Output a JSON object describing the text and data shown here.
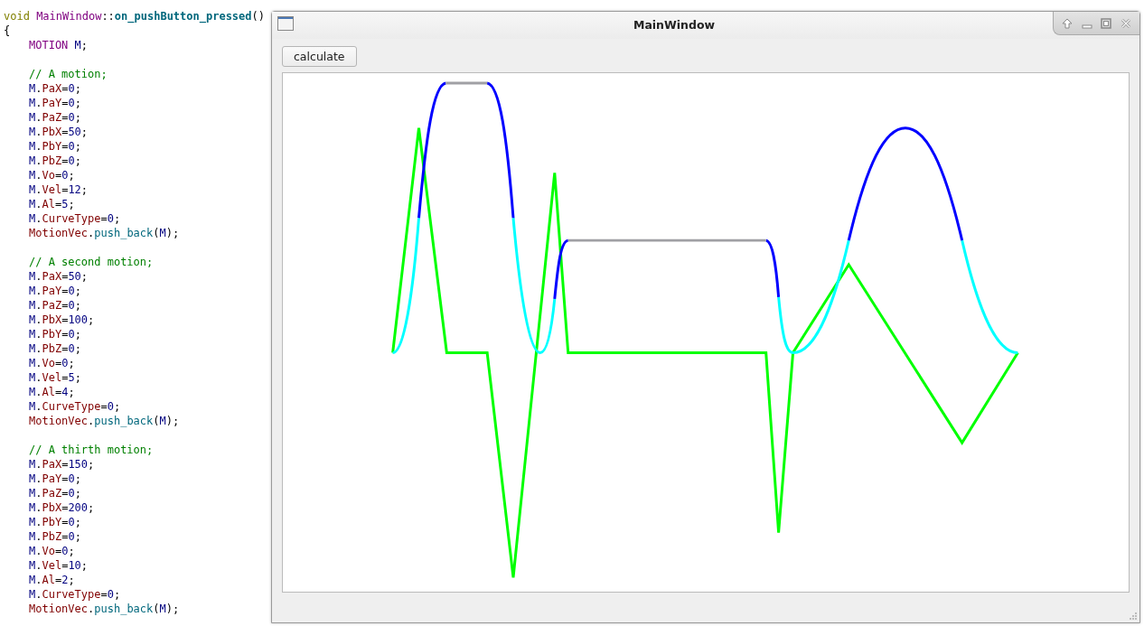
{
  "code_editor": {
    "lines": [
      {
        "kind": "code",
        "indented": false,
        "tokens": [
          {
            "kind": "keyword",
            "text": "void "
          },
          {
            "kind": "type",
            "text": "MainWindow"
          },
          {
            "kind": "plain",
            "text": "::"
          },
          {
            "kind": "funcdef",
            "text": "on_pushButton_pressed"
          },
          {
            "kind": "plain",
            "text": "()"
          }
        ]
      },
      {
        "kind": "code",
        "indented": false,
        "tokens": [
          {
            "kind": "plain",
            "text": "{"
          }
        ]
      },
      {
        "kind": "code",
        "indented": true,
        "tokens": [
          {
            "kind": "type",
            "text": "MOTION "
          },
          {
            "kind": "var",
            "text": "M"
          },
          {
            "kind": "plain",
            "text": ";"
          }
        ]
      },
      {
        "kind": "blank"
      },
      {
        "kind": "code",
        "indented": true,
        "tokens": [
          {
            "kind": "comment",
            "text": "// A motion;"
          }
        ]
      },
      {
        "kind": "code",
        "indented": true,
        "tokens": [
          {
            "kind": "var",
            "text": "M"
          },
          {
            "kind": "plain",
            "text": "."
          },
          {
            "kind": "member",
            "text": "PaX"
          },
          {
            "kind": "plain",
            "text": "="
          },
          {
            "kind": "number",
            "text": "0"
          },
          {
            "kind": "plain",
            "text": ";"
          }
        ]
      },
      {
        "kind": "code",
        "indented": true,
        "tokens": [
          {
            "kind": "var",
            "text": "M"
          },
          {
            "kind": "plain",
            "text": "."
          },
          {
            "kind": "member",
            "text": "PaY"
          },
          {
            "kind": "plain",
            "text": "="
          },
          {
            "kind": "number",
            "text": "0"
          },
          {
            "kind": "plain",
            "text": ";"
          }
        ]
      },
      {
        "kind": "code",
        "indented": true,
        "tokens": [
          {
            "kind": "var",
            "text": "M"
          },
          {
            "kind": "plain",
            "text": "."
          },
          {
            "kind": "member",
            "text": "PaZ"
          },
          {
            "kind": "plain",
            "text": "="
          },
          {
            "kind": "number",
            "text": "0"
          },
          {
            "kind": "plain",
            "text": ";"
          }
        ]
      },
      {
        "kind": "code",
        "indented": true,
        "tokens": [
          {
            "kind": "var",
            "text": "M"
          },
          {
            "kind": "plain",
            "text": "."
          },
          {
            "kind": "member",
            "text": "PbX"
          },
          {
            "kind": "plain",
            "text": "="
          },
          {
            "kind": "number",
            "text": "50"
          },
          {
            "kind": "plain",
            "text": ";"
          }
        ]
      },
      {
        "kind": "code",
        "indented": true,
        "tokens": [
          {
            "kind": "var",
            "text": "M"
          },
          {
            "kind": "plain",
            "text": "."
          },
          {
            "kind": "member",
            "text": "PbY"
          },
          {
            "kind": "plain",
            "text": "="
          },
          {
            "kind": "number",
            "text": "0"
          },
          {
            "kind": "plain",
            "text": ";"
          }
        ]
      },
      {
        "kind": "code",
        "indented": true,
        "tokens": [
          {
            "kind": "var",
            "text": "M"
          },
          {
            "kind": "plain",
            "text": "."
          },
          {
            "kind": "member",
            "text": "PbZ"
          },
          {
            "kind": "plain",
            "text": "="
          },
          {
            "kind": "number",
            "text": "0"
          },
          {
            "kind": "plain",
            "text": ";"
          }
        ]
      },
      {
        "kind": "code",
        "indented": true,
        "tokens": [
          {
            "kind": "var",
            "text": "M"
          },
          {
            "kind": "plain",
            "text": "."
          },
          {
            "kind": "member",
            "text": "Vo"
          },
          {
            "kind": "plain",
            "text": "="
          },
          {
            "kind": "number",
            "text": "0"
          },
          {
            "kind": "plain",
            "text": ";"
          }
        ]
      },
      {
        "kind": "code",
        "indented": true,
        "tokens": [
          {
            "kind": "var",
            "text": "M"
          },
          {
            "kind": "plain",
            "text": "."
          },
          {
            "kind": "member",
            "text": "Vel"
          },
          {
            "kind": "plain",
            "text": "="
          },
          {
            "kind": "number",
            "text": "12"
          },
          {
            "kind": "plain",
            "text": ";"
          }
        ]
      },
      {
        "kind": "code",
        "indented": true,
        "tokens": [
          {
            "kind": "var",
            "text": "M"
          },
          {
            "kind": "plain",
            "text": "."
          },
          {
            "kind": "member",
            "text": "Al"
          },
          {
            "kind": "plain",
            "text": "="
          },
          {
            "kind": "number",
            "text": "5"
          },
          {
            "kind": "plain",
            "text": ";"
          }
        ]
      },
      {
        "kind": "code",
        "indented": true,
        "tokens": [
          {
            "kind": "var",
            "text": "M"
          },
          {
            "kind": "plain",
            "text": "."
          },
          {
            "kind": "member",
            "text": "CurveType"
          },
          {
            "kind": "plain",
            "text": "="
          },
          {
            "kind": "number",
            "text": "0"
          },
          {
            "kind": "plain",
            "text": ";"
          }
        ]
      },
      {
        "kind": "code",
        "indented": true,
        "tokens": [
          {
            "kind": "member",
            "text": "MotionVec"
          },
          {
            "kind": "plain",
            "text": "."
          },
          {
            "kind": "func",
            "text": "push_back"
          },
          {
            "kind": "plain",
            "text": "("
          },
          {
            "kind": "var",
            "text": "M"
          },
          {
            "kind": "plain",
            "text": ");"
          }
        ]
      },
      {
        "kind": "blank"
      },
      {
        "kind": "code",
        "indented": true,
        "tokens": [
          {
            "kind": "comment",
            "text": "// A second motion;"
          }
        ]
      },
      {
        "kind": "code",
        "indented": true,
        "tokens": [
          {
            "kind": "var",
            "text": "M"
          },
          {
            "kind": "plain",
            "text": "."
          },
          {
            "kind": "member",
            "text": "PaX"
          },
          {
            "kind": "plain",
            "text": "="
          },
          {
            "kind": "number",
            "text": "50"
          },
          {
            "kind": "plain",
            "text": ";"
          }
        ]
      },
      {
        "kind": "code",
        "indented": true,
        "tokens": [
          {
            "kind": "var",
            "text": "M"
          },
          {
            "kind": "plain",
            "text": "."
          },
          {
            "kind": "member",
            "text": "PaY"
          },
          {
            "kind": "plain",
            "text": "="
          },
          {
            "kind": "number",
            "text": "0"
          },
          {
            "kind": "plain",
            "text": ";"
          }
        ]
      },
      {
        "kind": "code",
        "indented": true,
        "tokens": [
          {
            "kind": "var",
            "text": "M"
          },
          {
            "kind": "plain",
            "text": "."
          },
          {
            "kind": "member",
            "text": "PaZ"
          },
          {
            "kind": "plain",
            "text": "="
          },
          {
            "kind": "number",
            "text": "0"
          },
          {
            "kind": "plain",
            "text": ";"
          }
        ]
      },
      {
        "kind": "code",
        "indented": true,
        "tokens": [
          {
            "kind": "var",
            "text": "M"
          },
          {
            "kind": "plain",
            "text": "."
          },
          {
            "kind": "member",
            "text": "PbX"
          },
          {
            "kind": "plain",
            "text": "="
          },
          {
            "kind": "number",
            "text": "100"
          },
          {
            "kind": "plain",
            "text": ";"
          }
        ]
      },
      {
        "kind": "code",
        "indented": true,
        "tokens": [
          {
            "kind": "var",
            "text": "M"
          },
          {
            "kind": "plain",
            "text": "."
          },
          {
            "kind": "member",
            "text": "PbY"
          },
          {
            "kind": "plain",
            "text": "="
          },
          {
            "kind": "number",
            "text": "0"
          },
          {
            "kind": "plain",
            "text": ";"
          }
        ]
      },
      {
        "kind": "code",
        "indented": true,
        "tokens": [
          {
            "kind": "var",
            "text": "M"
          },
          {
            "kind": "plain",
            "text": "."
          },
          {
            "kind": "member",
            "text": "PbZ"
          },
          {
            "kind": "plain",
            "text": "="
          },
          {
            "kind": "number",
            "text": "0"
          },
          {
            "kind": "plain",
            "text": ";"
          }
        ]
      },
      {
        "kind": "code",
        "indented": true,
        "tokens": [
          {
            "kind": "var",
            "text": "M"
          },
          {
            "kind": "plain",
            "text": "."
          },
          {
            "kind": "member",
            "text": "Vo"
          },
          {
            "kind": "plain",
            "text": "="
          },
          {
            "kind": "number",
            "text": "0"
          },
          {
            "kind": "plain",
            "text": ";"
          }
        ]
      },
      {
        "kind": "code",
        "indented": true,
        "tokens": [
          {
            "kind": "var",
            "text": "M"
          },
          {
            "kind": "plain",
            "text": "."
          },
          {
            "kind": "member",
            "text": "Vel"
          },
          {
            "kind": "plain",
            "text": "="
          },
          {
            "kind": "number",
            "text": "5"
          },
          {
            "kind": "plain",
            "text": ";"
          }
        ]
      },
      {
        "kind": "code",
        "indented": true,
        "tokens": [
          {
            "kind": "var",
            "text": "M"
          },
          {
            "kind": "plain",
            "text": "."
          },
          {
            "kind": "member",
            "text": "Al"
          },
          {
            "kind": "plain",
            "text": "="
          },
          {
            "kind": "number",
            "text": "4"
          },
          {
            "kind": "plain",
            "text": ";"
          }
        ]
      },
      {
        "kind": "code",
        "indented": true,
        "tokens": [
          {
            "kind": "var",
            "text": "M"
          },
          {
            "kind": "plain",
            "text": "."
          },
          {
            "kind": "member",
            "text": "CurveType"
          },
          {
            "kind": "plain",
            "text": "="
          },
          {
            "kind": "number",
            "text": "0"
          },
          {
            "kind": "plain",
            "text": ";"
          }
        ]
      },
      {
        "kind": "code",
        "indented": true,
        "tokens": [
          {
            "kind": "member",
            "text": "MotionVec"
          },
          {
            "kind": "plain",
            "text": "."
          },
          {
            "kind": "func",
            "text": "push_back"
          },
          {
            "kind": "plain",
            "text": "("
          },
          {
            "kind": "var",
            "text": "M"
          },
          {
            "kind": "plain",
            "text": ");"
          }
        ]
      },
      {
        "kind": "blank"
      },
      {
        "kind": "code",
        "indented": true,
        "tokens": [
          {
            "kind": "comment",
            "text": "// A thirth motion;"
          }
        ]
      },
      {
        "kind": "code",
        "indented": true,
        "tokens": [
          {
            "kind": "var",
            "text": "M"
          },
          {
            "kind": "plain",
            "text": "."
          },
          {
            "kind": "member",
            "text": "PaX"
          },
          {
            "kind": "plain",
            "text": "="
          },
          {
            "kind": "number",
            "text": "150"
          },
          {
            "kind": "plain",
            "text": ";"
          }
        ]
      },
      {
        "kind": "code",
        "indented": true,
        "tokens": [
          {
            "kind": "var",
            "text": "M"
          },
          {
            "kind": "plain",
            "text": "."
          },
          {
            "kind": "member",
            "text": "PaY"
          },
          {
            "kind": "plain",
            "text": "="
          },
          {
            "kind": "number",
            "text": "0"
          },
          {
            "kind": "plain",
            "text": ";"
          }
        ]
      },
      {
        "kind": "code",
        "indented": true,
        "tokens": [
          {
            "kind": "var",
            "text": "M"
          },
          {
            "kind": "plain",
            "text": "."
          },
          {
            "kind": "member",
            "text": "PaZ"
          },
          {
            "kind": "plain",
            "text": "="
          },
          {
            "kind": "number",
            "text": "0"
          },
          {
            "kind": "plain",
            "text": ";"
          }
        ]
      },
      {
        "kind": "code",
        "indented": true,
        "tokens": [
          {
            "kind": "var",
            "text": "M"
          },
          {
            "kind": "plain",
            "text": "."
          },
          {
            "kind": "member",
            "text": "PbX"
          },
          {
            "kind": "plain",
            "text": "="
          },
          {
            "kind": "number",
            "text": "200"
          },
          {
            "kind": "plain",
            "text": ";"
          }
        ]
      },
      {
        "kind": "code",
        "indented": true,
        "tokens": [
          {
            "kind": "var",
            "text": "M"
          },
          {
            "kind": "plain",
            "text": "."
          },
          {
            "kind": "member",
            "text": "PbY"
          },
          {
            "kind": "plain",
            "text": "="
          },
          {
            "kind": "number",
            "text": "0"
          },
          {
            "kind": "plain",
            "text": ";"
          }
        ]
      },
      {
        "kind": "code",
        "indented": true,
        "tokens": [
          {
            "kind": "var",
            "text": "M"
          },
          {
            "kind": "plain",
            "text": "."
          },
          {
            "kind": "member",
            "text": "PbZ"
          },
          {
            "kind": "plain",
            "text": "="
          },
          {
            "kind": "number",
            "text": "0"
          },
          {
            "kind": "plain",
            "text": ";"
          }
        ]
      },
      {
        "kind": "code",
        "indented": true,
        "tokens": [
          {
            "kind": "var",
            "text": "M"
          },
          {
            "kind": "plain",
            "text": "."
          },
          {
            "kind": "member",
            "text": "Vo"
          },
          {
            "kind": "plain",
            "text": "="
          },
          {
            "kind": "number",
            "text": "0"
          },
          {
            "kind": "plain",
            "text": ";"
          }
        ]
      },
      {
        "kind": "code",
        "indented": true,
        "tokens": [
          {
            "kind": "var",
            "text": "M"
          },
          {
            "kind": "plain",
            "text": "."
          },
          {
            "kind": "member",
            "text": "Vel"
          },
          {
            "kind": "plain",
            "text": "="
          },
          {
            "kind": "number",
            "text": "10"
          },
          {
            "kind": "plain",
            "text": ";"
          }
        ]
      },
      {
        "kind": "code",
        "indented": true,
        "tokens": [
          {
            "kind": "var",
            "text": "M"
          },
          {
            "kind": "plain",
            "text": "."
          },
          {
            "kind": "member",
            "text": "Al"
          },
          {
            "kind": "plain",
            "text": "="
          },
          {
            "kind": "number",
            "text": "2"
          },
          {
            "kind": "plain",
            "text": ";"
          }
        ]
      },
      {
        "kind": "code",
        "indented": true,
        "tokens": [
          {
            "kind": "var",
            "text": "M"
          },
          {
            "kind": "plain",
            "text": "."
          },
          {
            "kind": "member",
            "text": "CurveType"
          },
          {
            "kind": "plain",
            "text": "="
          },
          {
            "kind": "number",
            "text": "0"
          },
          {
            "kind": "plain",
            "text": ";"
          }
        ]
      },
      {
        "kind": "code",
        "indented": true,
        "tokens": [
          {
            "kind": "member",
            "text": "MotionVec"
          },
          {
            "kind": "plain",
            "text": "."
          },
          {
            "kind": "func",
            "text": "push_back"
          },
          {
            "kind": "plain",
            "text": "("
          },
          {
            "kind": "var",
            "text": "M"
          },
          {
            "kind": "plain",
            "text": ");"
          }
        ]
      }
    ]
  },
  "window": {
    "title": "MainWindow",
    "button": "calculate"
  }
}
